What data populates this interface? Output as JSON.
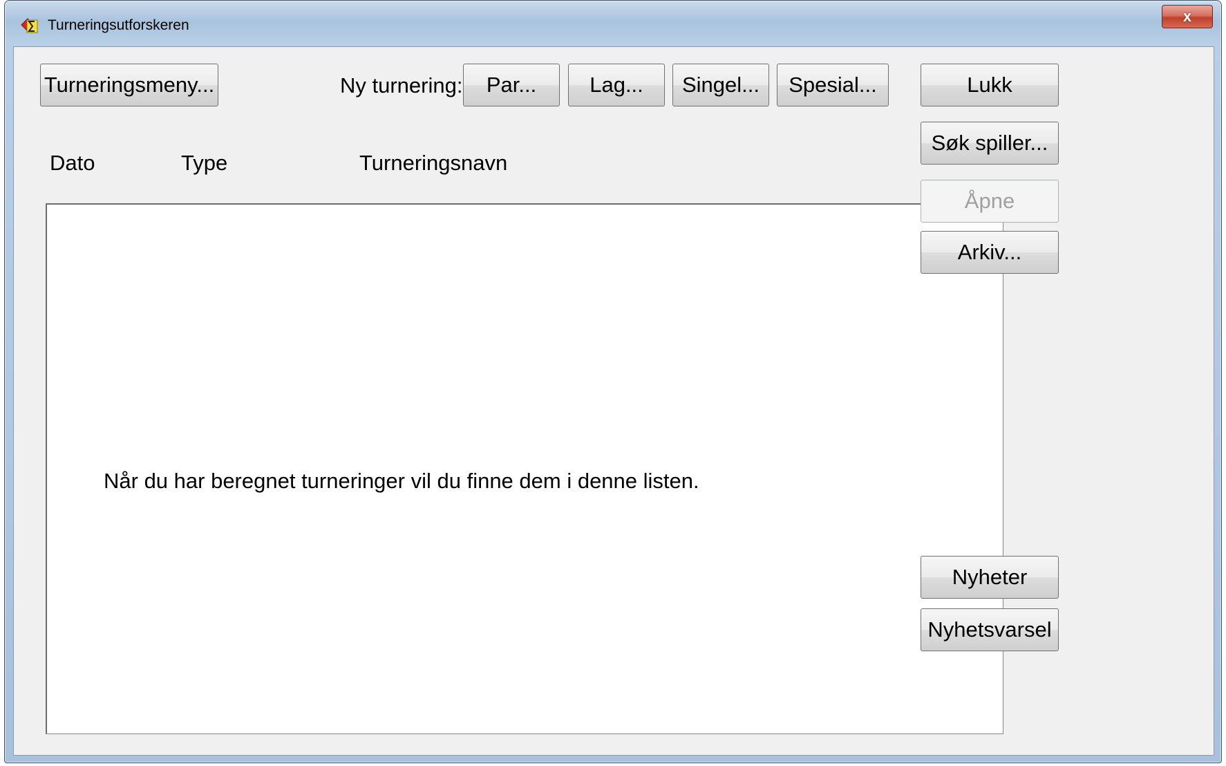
{
  "window": {
    "title": "Turneringsutforskeren",
    "close_label": "x"
  },
  "toolbar": {
    "tournament_menu_label": "Turneringsmeny...",
    "new_tournament_label": "Ny turnering:",
    "pair_label": "Par...",
    "team_label": "Lag...",
    "single_label": "Singel...",
    "special_label": "Spesial..."
  },
  "list": {
    "columns": [
      "Dato",
      "Type",
      "Turneringsnavn"
    ],
    "empty_message": "Når du har beregnet turneringer vil du finne dem i denne listen."
  },
  "sidebar": {
    "close_label": "Lukk",
    "search_player_label": "Søk spiller...",
    "open_label": "Åpne",
    "archive_label": "Arkiv...",
    "news_label": "Nyheter",
    "news_alert_label": "Nyhetsvarsel"
  },
  "icons": {
    "app": "sigma-diamond-icon",
    "close": "close-icon"
  },
  "colors": {
    "close_button": "#c9503c",
    "disabled_text": "#a0a0a0"
  }
}
